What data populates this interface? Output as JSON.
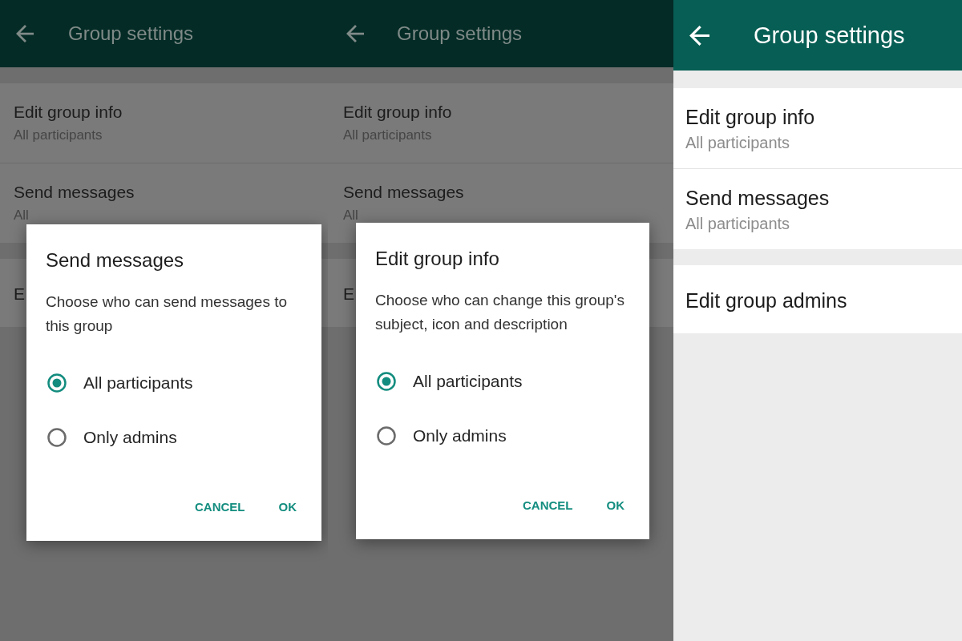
{
  "screens": [
    {
      "toolbar": {
        "title": "Group settings"
      },
      "sections": [
        {
          "items": [
            {
              "title": "Edit group info",
              "subtitle": "All participants"
            },
            {
              "title": "Send messages",
              "subtitle": "All"
            }
          ]
        },
        {
          "items": [
            {
              "title": "E"
            }
          ]
        }
      ],
      "dialog": {
        "title": "Send messages",
        "message": "Choose who can send messages to this group",
        "options": [
          {
            "label": "All participants",
            "selected": true
          },
          {
            "label": "Only admins",
            "selected": false
          }
        ],
        "buttons": [
          "CANCEL",
          "OK"
        ]
      }
    },
    {
      "toolbar": {
        "title": "Group settings"
      },
      "sections": [
        {
          "items": [
            {
              "title": "Edit group info",
              "subtitle": "All participants"
            },
            {
              "title": "Send messages",
              "subtitle": "All"
            }
          ]
        },
        {
          "items": [
            {
              "title": "E"
            }
          ]
        }
      ],
      "dialog": {
        "title": "Edit group info",
        "message": "Choose who can change this group's subject, icon and description",
        "options": [
          {
            "label": "All participants",
            "selected": true
          },
          {
            "label": "Only admins",
            "selected": false
          }
        ],
        "buttons": [
          "CANCEL",
          "OK"
        ]
      }
    },
    {
      "toolbar": {
        "title": "Group settings"
      },
      "sections": [
        {
          "items": [
            {
              "title": "Edit group info",
              "subtitle": "All participants"
            },
            {
              "title": "Send messages",
              "subtitle": "All participants"
            }
          ]
        },
        {
          "items": [
            {
              "title": "Edit group admins"
            }
          ]
        }
      ]
    }
  ]
}
